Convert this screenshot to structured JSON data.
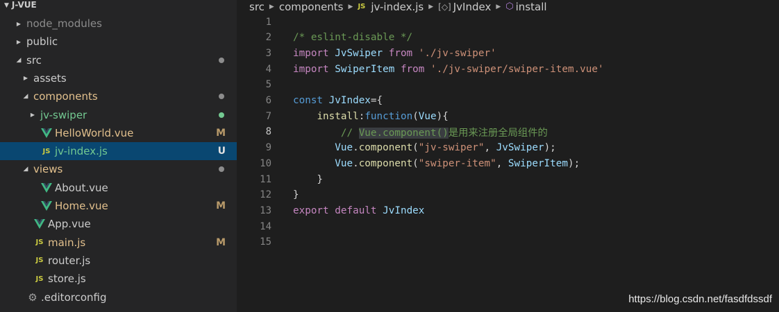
{
  "explorer": {
    "root_label": "J-VUE",
    "items": [
      {
        "label": "node_modules",
        "type": "folder",
        "state": "collapsed",
        "depth": 0,
        "color": "#8c8c8c"
      },
      {
        "label": "public",
        "type": "folder",
        "state": "collapsed",
        "depth": 0,
        "color": "#cccccc"
      },
      {
        "label": "src",
        "type": "folder",
        "state": "expanded",
        "depth": 0,
        "color": "#cccccc",
        "dot": "#8c8c8c"
      },
      {
        "label": "assets",
        "type": "folder",
        "state": "collapsed",
        "depth": 1,
        "color": "#cccccc"
      },
      {
        "label": "components",
        "type": "folder",
        "state": "expanded",
        "depth": 1,
        "color": "#e2c08d",
        "dot": "#8c8c8c"
      },
      {
        "label": "jv-swiper",
        "type": "folder",
        "state": "collapsed",
        "depth": 2,
        "color": "#73c991",
        "dot": "#73c991"
      },
      {
        "label": "HelloWorld.vue",
        "type": "vue",
        "depth": 2,
        "color": "#e2c08d",
        "badge": "M"
      },
      {
        "label": "jv-index.js",
        "type": "js",
        "depth": 2,
        "color": "#73c991",
        "badge": "U",
        "selected": true
      },
      {
        "label": "views",
        "type": "folder",
        "state": "expanded",
        "depth": 1,
        "color": "#e2c08d",
        "dot": "#8c8c8c"
      },
      {
        "label": "About.vue",
        "type": "vue",
        "depth": 2,
        "color": "#cccccc"
      },
      {
        "label": "Home.vue",
        "type": "vue",
        "depth": 2,
        "color": "#e2c08d",
        "badge": "M"
      },
      {
        "label": "App.vue",
        "type": "vue",
        "depth": 1,
        "color": "#cccccc"
      },
      {
        "label": "main.js",
        "type": "js",
        "depth": 1,
        "color": "#e2c08d",
        "badge": "M"
      },
      {
        "label": "router.js",
        "type": "js",
        "depth": 1,
        "color": "#cccccc"
      },
      {
        "label": "store.js",
        "type": "js",
        "depth": 1,
        "color": "#cccccc"
      },
      {
        "label": ".editorconfig",
        "type": "gear",
        "depth": 0,
        "color": "#cccccc"
      }
    ]
  },
  "breadcrumb": {
    "items": [
      "src",
      "components",
      "jv-index.js",
      "JvIndex",
      "install"
    ],
    "js_icon": "JS",
    "symbol_icon": "symbol-variable-icon",
    "method_icon": "symbol-method-icon"
  },
  "editor": {
    "active_line": 8,
    "lines": [
      {
        "n": "1",
        "tokens": []
      },
      {
        "n": "2",
        "tokens": [
          [
            "cm",
            "/* eslint-disable */"
          ]
        ]
      },
      {
        "n": "3",
        "tokens": [
          [
            "kw",
            "import "
          ],
          [
            "vr",
            "JvSwiper "
          ],
          [
            "kw",
            "from "
          ],
          [
            "st",
            "'./jv-swiper'"
          ]
        ]
      },
      {
        "n": "4",
        "tokens": [
          [
            "kw",
            "import "
          ],
          [
            "vr",
            "SwiperItem "
          ],
          [
            "kw",
            "from "
          ],
          [
            "st",
            "'./jv-swiper/swiper-item.vue'"
          ]
        ]
      },
      {
        "n": "5",
        "tokens": []
      },
      {
        "n": "6",
        "tokens": [
          [
            "kw2",
            "const "
          ],
          [
            "vr",
            "JvIndex"
          ],
          [
            "pl",
            "={"
          ]
        ]
      },
      {
        "n": "7",
        "tokens": [
          [
            "pl",
            "    "
          ],
          [
            "fn",
            "install"
          ],
          [
            "pl",
            ":"
          ],
          [
            "kw2",
            "function"
          ],
          [
            "pl",
            "("
          ],
          [
            "vr",
            "Vue"
          ],
          [
            "pl",
            "){"
          ]
        ]
      },
      {
        "n": "8",
        "tokens": [
          [
            "pl",
            "        "
          ],
          [
            "cm",
            "// "
          ],
          [
            "cmhl",
            "Vue.component()"
          ],
          [
            "cm",
            "是用来注册全局组件的"
          ]
        ]
      },
      {
        "n": "9",
        "tokens": [
          [
            "pl",
            "       "
          ],
          [
            "vr",
            "Vue"
          ],
          [
            "pl",
            "."
          ],
          [
            "fn",
            "component"
          ],
          [
            "pl",
            "("
          ],
          [
            "st",
            "\"jv-swiper\""
          ],
          [
            "pl",
            ", "
          ],
          [
            "vr",
            "JvSwiper"
          ],
          [
            "pl",
            ");"
          ]
        ]
      },
      {
        "n": "10",
        "tokens": [
          [
            "pl",
            "       "
          ],
          [
            "vr",
            "Vue"
          ],
          [
            "pl",
            "."
          ],
          [
            "fn",
            "component"
          ],
          [
            "pl",
            "("
          ],
          [
            "st",
            "\"swiper-item\""
          ],
          [
            "pl",
            ", "
          ],
          [
            "vr",
            "SwiperItem"
          ],
          [
            "pl",
            ");"
          ]
        ]
      },
      {
        "n": "11",
        "tokens": [
          [
            "pl",
            "    }"
          ]
        ]
      },
      {
        "n": "12",
        "tokens": [
          [
            "pl",
            "}"
          ]
        ]
      },
      {
        "n": "13",
        "tokens": [
          [
            "kw",
            "export "
          ],
          [
            "kw",
            "default "
          ],
          [
            "vr",
            "JvIndex"
          ]
        ]
      },
      {
        "n": "14",
        "tokens": []
      },
      {
        "n": "15",
        "tokens": []
      }
    ]
  },
  "watermark": "https://blog.csdn.net/fasdfdssdf"
}
